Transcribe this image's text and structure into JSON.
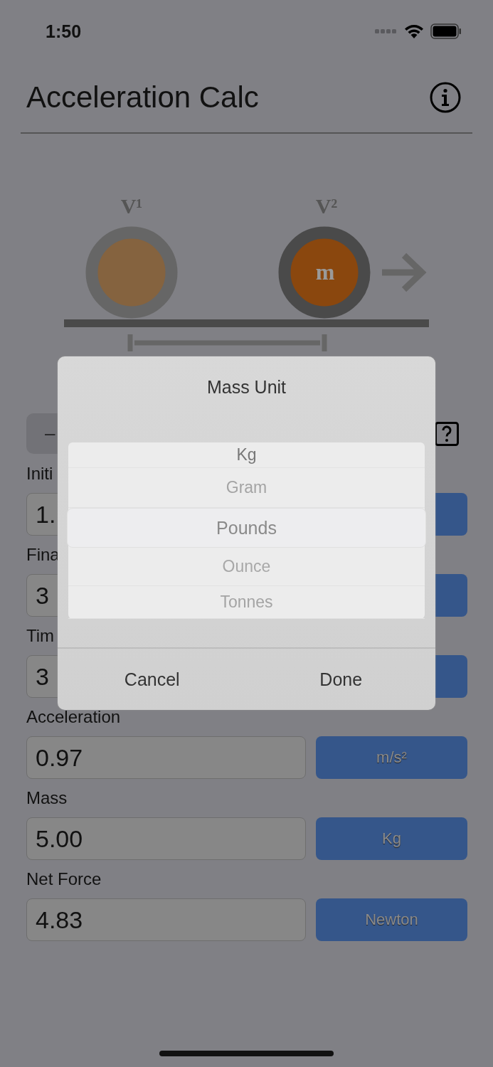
{
  "status_bar": {
    "time": "1:50"
  },
  "header": {
    "title": "Acceleration Calc"
  },
  "diagram": {
    "labels": [
      "V¹",
      "V²"
    ],
    "mass_label": "m"
  },
  "toolbar": {
    "minus_label": "–"
  },
  "fields": [
    {
      "label": "Initi",
      "value": "1."
    },
    {
      "label": "Fina",
      "value": "3"
    },
    {
      "label": "Tim",
      "value": "3"
    },
    {
      "label": "Acceleration",
      "value": "0.97",
      "unit": "m/s²"
    },
    {
      "label": "Mass",
      "value": "5.00",
      "unit": "Kg"
    },
    {
      "label": "Net Force",
      "value": "4.83",
      "unit": "Newton"
    }
  ],
  "dialog": {
    "title": "Mass Unit",
    "options": [
      {
        "label": "Kg",
        "selected": false
      },
      {
        "label": "Gram",
        "selected": false
      },
      {
        "label": "Pounds",
        "selected": true
      },
      {
        "label": "Ounce",
        "selected": false
      },
      {
        "label": "Tonnes",
        "selected": false
      }
    ],
    "buttons": [
      "Cancel",
      "Done"
    ]
  }
}
